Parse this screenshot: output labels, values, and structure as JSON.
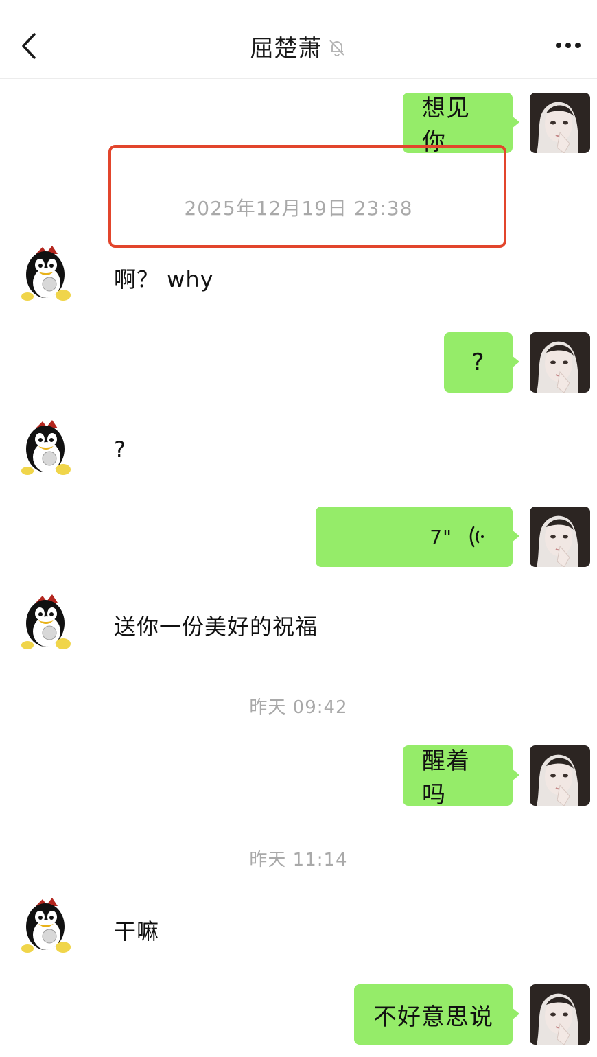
{
  "header": {
    "title": "屈楚萧",
    "back_icon": "chevron-left-icon",
    "mute_icon": "bell-off-icon",
    "more_icon": "more-dots-icon"
  },
  "messages": [
    {
      "side": "out",
      "type": "text",
      "text": "想见你"
    },
    {
      "type": "time",
      "text": "2025年12月19日 23:38"
    },
    {
      "side": "in",
      "type": "text",
      "text": "啊？ why"
    },
    {
      "side": "out",
      "type": "text",
      "text": "?"
    },
    {
      "side": "in",
      "type": "text",
      "text": "?"
    },
    {
      "side": "out",
      "type": "voice",
      "duration": "7\"",
      "icon": "voice-wave-icon"
    },
    {
      "side": "in",
      "type": "text",
      "text": "送你一份美好的祝福"
    },
    {
      "type": "time",
      "text": "昨天 09:42"
    },
    {
      "side": "out",
      "type": "text",
      "text": "醒着吗"
    },
    {
      "type": "time",
      "text": "昨天 11:14"
    },
    {
      "side": "in",
      "type": "text",
      "text": "干嘛"
    },
    {
      "side": "out",
      "type": "text",
      "text": "不好意思说"
    }
  ],
  "colors": {
    "bubble_out": "#95ec69",
    "highlight_box": "#e2452c",
    "timestamp": "#a9a9a9"
  }
}
